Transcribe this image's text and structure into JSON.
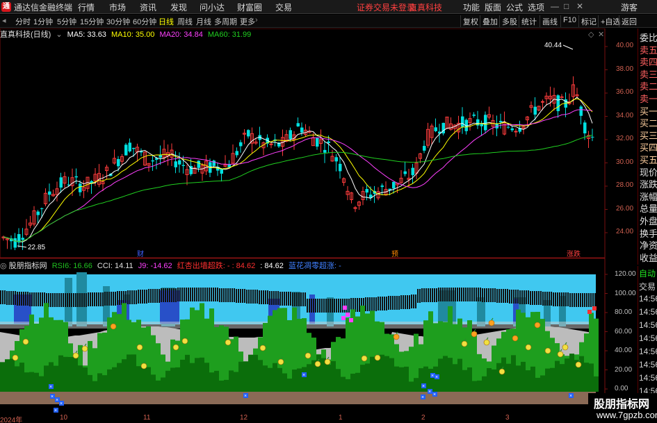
{
  "app": {
    "logo": "通",
    "title": "通达信金融终端",
    "menu": [
      "行情",
      "市场",
      "资讯",
      "发现",
      "问小达",
      "财富圈",
      "交易"
    ],
    "warning": "证券交易未登录",
    "warning2": "直真科技",
    "right_menu": [
      "功能",
      "版面",
      "公式",
      "选项"
    ],
    "guest": "游客"
  },
  "periods": {
    "items": [
      "分时",
      "1分钟",
      "5分钟",
      "15分钟",
      "30分钟",
      "60分钟",
      "日线",
      "周线",
      "月线",
      "多周期",
      "更多"
    ],
    "selected": "日线",
    "right_buttons": [
      "复权",
      "叠加",
      "多股",
      "统计",
      "画线",
      "F10",
      "标记",
      "+自选",
      "返回"
    ]
  },
  "main_chart": {
    "title": "直真科技(日线)",
    "ma5": "MA5: 33.63",
    "ma10": "MA10: 35.00",
    "ma20": "MA20: 34.84",
    "ma60": "MA60: 31.99",
    "high_label": "40.44",
    "low_label": "22.85",
    "yticks": [
      "40.00",
      "38.00",
      "36.00",
      "34.00",
      "32.00",
      "30.00",
      "28.00",
      "26.00",
      "24.00"
    ],
    "markers": [
      "财",
      "预",
      "涨跌"
    ],
    "colors": {
      "up": "#ff3c3c",
      "down": "#00e0e0",
      "ma5": "#ffffff",
      "ma10": "#ffff00",
      "ma20": "#ff40ff",
      "ma60": "#20d020"
    }
  },
  "side_panel": [
    "委比",
    "卖五",
    "卖四",
    "卖三",
    "卖二",
    "卖一",
    "买一",
    "买二",
    "买三",
    "买四",
    "买五",
    "现价",
    "涨跌",
    "涨幅",
    "总量",
    "外盘",
    "换手",
    "净资",
    "收益"
  ],
  "side_panel2": [
    "自动",
    "交易",
    "14:56",
    "14:56",
    "14:56",
    "14:56",
    "14:56",
    "14:56",
    "14:56",
    "14:56",
    "14:56"
  ],
  "indicator": {
    "name": "股朋指标网",
    "rsi": "RSI6: 16.66",
    "cci": "CCI: 14.11",
    "j9": "J9: -14.62",
    "red_text": "红杏出墙超跌: -",
    "v1": ": 84.62",
    "v2": ": 84.62",
    "blue_text": "蓝花凋零超涨: -",
    "yticks": [
      "120.00",
      "100.00",
      "80.00",
      "60.00",
      "40.00",
      "20.00",
      "0.00"
    ]
  },
  "xaxis": {
    "labels": [
      "2024年",
      "10",
      "11",
      "12",
      "1",
      "2",
      "3"
    ]
  },
  "watermark": {
    "line1": "股朋指标网",
    "line2": "www.7gpzb.com"
  }
}
